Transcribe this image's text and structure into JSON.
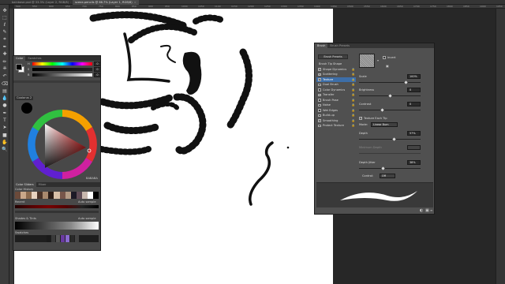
{
  "doc_tabs": [
    {
      "label": "bainbase.psd @ 33.3% (Layer 2, RGB/8)",
      "close": "×"
    },
    {
      "label": "scene-pencils @ 66.7% (Layer 1, RGB/8)",
      "close": "×"
    }
  ],
  "ruler_numbers": [
    "500",
    "550",
    "600",
    "650",
    "700",
    "750",
    "800",
    "850",
    "900",
    "950",
    "1000",
    "1050",
    "1100",
    "1150",
    "1200",
    "1250",
    "1300",
    "1350",
    "1400",
    "1450",
    "1500",
    "1550",
    "1600",
    "1650",
    "1700",
    "1750",
    "1800",
    "1850",
    "1900",
    "1950"
  ],
  "tools": [
    "move-tool",
    "marquee-tool",
    "lasso-tool",
    "quick-select-tool",
    "crop-tool",
    "eyedropper-tool",
    "healing-brush-tool",
    "brush-tool",
    "clone-stamp-tool",
    "history-brush-tool",
    "eraser-tool",
    "gradient-tool",
    "blur-tool",
    "dodge-tool",
    "pen-tool",
    "type-tool",
    "path-select-tool",
    "shape-tool",
    "hand-tool",
    "zoom-tool"
  ],
  "tool_glyphs": [
    "✥",
    "⬚",
    "ℓ",
    "✎",
    "⌗",
    "✒",
    "✚",
    "✏",
    "⎈",
    "↶",
    "⌫",
    "▤",
    "💧",
    "●",
    "✒",
    "T",
    "➤",
    "■",
    "✋",
    "🔍"
  ],
  "color_panel": {
    "tabs": [
      "Color",
      "Swatches"
    ],
    "sliders": [
      {
        "label": "H",
        "value": "0"
      },
      {
        "label": "S",
        "value": "0"
      },
      {
        "label": "B",
        "value": "0"
      }
    ],
    "wheel_section": "Coolorus 2",
    "hex_value": "BABABA",
    "bottom_tabs": [
      "Color Sliders",
      "Mixer"
    ],
    "history_label": "Color History",
    "recent_label": "Recent",
    "recent_action": "Auto sample",
    "shades_label": "Shades & Tints",
    "shades_action": "Auto sample",
    "swatches_label": "Swatches",
    "foreground": "#000000",
    "background": "#ffffff",
    "history_colors": [
      "#6b4a3a",
      "#c9a88a",
      "#8b6a4e",
      "#e8d3bf",
      "#4a3328",
      "#a98a6e",
      "#2b1d17",
      "#d8c0a8",
      "#77564a",
      "#b39a84",
      "#1c1a26",
      "#5e4b55",
      "#c8b8ae",
      "#ffffff",
      "#000000"
    ],
    "recent_colors": [
      "#3a2a24",
      "#6e5244",
      "#a07c66",
      "#5a0000",
      "#8a2a2a",
      "#c07060",
      "#4a3a6a",
      "#000000",
      "#ffffff",
      "#7a6a5a",
      "#d0c0b0",
      "#222222"
    ],
    "swatch_colors": [
      "#1a1a1a",
      "#3a3a3a",
      "#555555",
      "#6a3aa0",
      "#8a6ad0",
      "#2a2a2a",
      "#444444"
    ]
  },
  "brush_panel": {
    "tabs": [
      "Brush",
      "Brush Presets"
    ],
    "presets_button": "Brush Presets",
    "invert_label": "Invert",
    "items": [
      {
        "label": "Brush Tip Shape",
        "checkbox": false,
        "checked": false,
        "selected": false
      },
      {
        "label": "Shape Dynamics",
        "checkbox": true,
        "checked": true,
        "selected": false
      },
      {
        "label": "Scattering",
        "checkbox": true,
        "checked": true,
        "selected": false
      },
      {
        "label": "Texture",
        "checkbox": true,
        "checked": true,
        "selected": true
      },
      {
        "label": "Dual Brush",
        "checkbox": true,
        "checked": false,
        "selected": false
      },
      {
        "label": "Color Dynamics",
        "checkbox": true,
        "checked": false,
        "selected": false
      },
      {
        "label": "Transfer",
        "checkbox": true,
        "checked": true,
        "selected": false
      },
      {
        "label": "Brush Pose",
        "checkbox": true,
        "checked": false,
        "selected": false
      },
      {
        "label": "Noise",
        "checkbox": true,
        "checked": false,
        "selected": false
      },
      {
        "label": "Wet Edges",
        "checkbox": true,
        "checked": false,
        "selected": false
      },
      {
        "label": "Build-up",
        "checkbox": true,
        "checked": false,
        "selected": false
      },
      {
        "label": "Smoothing",
        "checkbox": true,
        "checked": true,
        "selected": false
      },
      {
        "label": "Protect Texture",
        "checkbox": true,
        "checked": false,
        "selected": false
      }
    ],
    "scale_label": "Scale",
    "scale_value": "100%",
    "brightness_label": "Brightness",
    "brightness_value": "0",
    "contrast_label": "Contrast",
    "contrast_value": "0",
    "texture_each_tip_label": "Texture Each Tip",
    "mode_label": "Mode:",
    "mode_value": "Linear Burn",
    "depth_label": "Depth",
    "depth_value": "57%",
    "min_depth_label": "Minimum Depth",
    "depth_jitter_label": "Depth Jitter",
    "depth_jitter_value": "38%",
    "control_label": "Control:",
    "control_value": "Off"
  }
}
